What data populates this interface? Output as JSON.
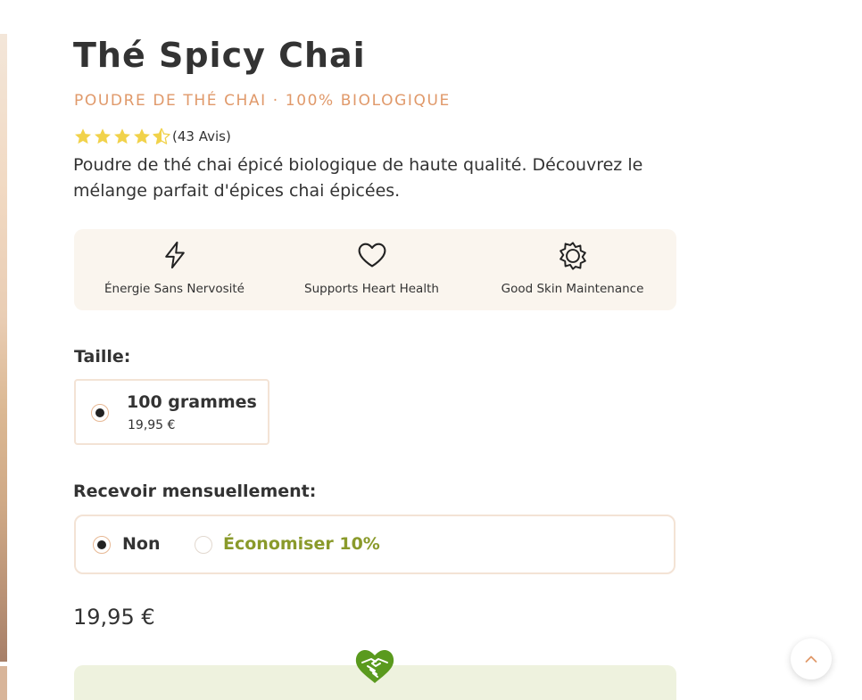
{
  "product": {
    "title": "Thé Spicy Chai",
    "subtitle": "POUDRE DE THÉ CHAI · 100% BIOLOGIQUE",
    "rating": {
      "stars": 4.5,
      "max": 5,
      "review_count_text": "(43 Avis)"
    },
    "description": "Poudre de thé chai épicé biologique de haute qualité. Découvrez le mélange parfait d'épices chai épicées."
  },
  "benefits": [
    {
      "icon": "lightning-icon",
      "label": "Énergie Sans Nervosité"
    },
    {
      "icon": "heart-icon",
      "label": "Supports Heart Health"
    },
    {
      "icon": "sun-icon",
      "label": "Good Skin Maintenance"
    }
  ],
  "size": {
    "label": "Taille:",
    "options": [
      {
        "name": "100 grammes",
        "price": "19,95 €",
        "selected": true
      }
    ]
  },
  "subscription": {
    "label": "Recevoir mensuellement:",
    "options": [
      {
        "label": "Non",
        "selected": true
      },
      {
        "label": "Économiser 10%",
        "selected": false
      }
    ]
  },
  "price": "19,95 €",
  "colors": {
    "accent": "#e0996a",
    "star": "#f1d24a",
    "save_green": "#8a9a2b",
    "handshake_green": "#5a9a1e",
    "benefits_bg": "#faf5ee",
    "promo_bg": "#eef2de"
  },
  "icons": {
    "promo": "handshake-heart-icon",
    "scroll_top": "chevron-up-icon"
  }
}
